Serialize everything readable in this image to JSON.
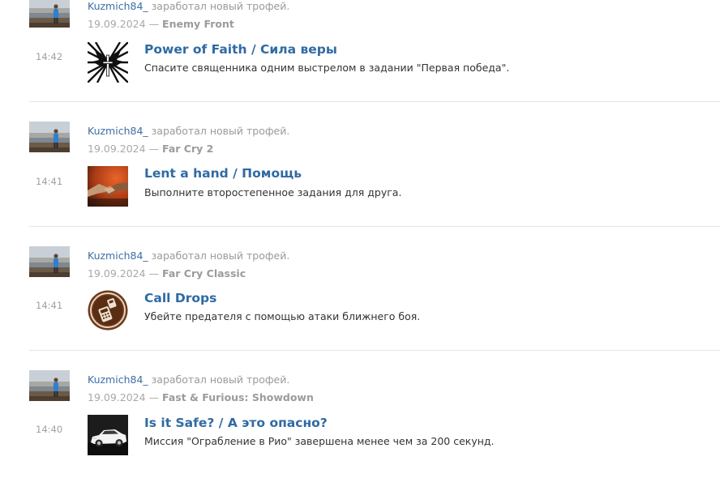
{
  "feed": {
    "entries": [
      {
        "username": "Kuzmich84_",
        "action": "заработал новый трофей.",
        "date": "19.09.2024",
        "separator": "—",
        "game": "Enemy Front",
        "time": "14:42",
        "trophy_title": "Power of Faith / Сила веры",
        "trophy_desc": "Спасите священника одним выстрелом в задании \"Первая победа\"."
      },
      {
        "username": "Kuzmich84_",
        "action": "заработал новый трофей.",
        "date": "19.09.2024",
        "separator": "—",
        "game": "Far Cry 2",
        "time": "14:41",
        "trophy_title": "Lent a hand / Помощь",
        "trophy_desc": "Выполните второстепенное задания для друга."
      },
      {
        "username": "Kuzmich84_",
        "action": "заработал новый трофей.",
        "date": "19.09.2024",
        "separator": "—",
        "game": "Far Cry Classic",
        "time": "14:41",
        "trophy_title": "Call Drops",
        "trophy_desc": "Убейте предателя с помощью атаки ближнего боя."
      },
      {
        "username": "Kuzmich84_",
        "action": "заработал новый трофей.",
        "date": "19.09.2024",
        "separator": "—",
        "game": "Fast & Furious: Showdown",
        "time": "14:40",
        "trophy_title": "Is it Safe? / А это опасно?",
        "trophy_desc": "Миссия \"Ограбление в Рио\" завершена менее чем за 200 секунд."
      }
    ]
  }
}
